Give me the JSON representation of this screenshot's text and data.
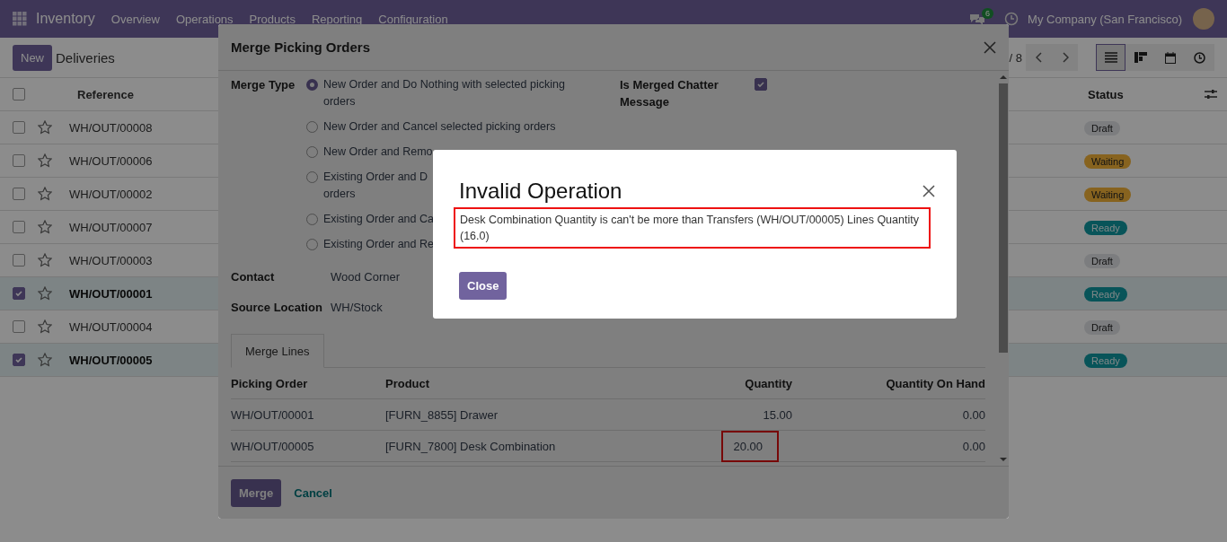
{
  "navbar": {
    "app": "Inventory",
    "menu": [
      "Overview",
      "Operations",
      "Products",
      "Reporting",
      "Configuration"
    ],
    "chat_badge": "6",
    "company": "My Company (San Francisco)"
  },
  "control_bar": {
    "new_button": "New",
    "breadcrumb": "Deliveries",
    "pager": "/ 8",
    "views": [
      {
        "kind": "list",
        "selected": true
      },
      {
        "kind": "kanban",
        "selected": false
      },
      {
        "kind": "calendar",
        "selected": false
      },
      {
        "kind": "activity",
        "selected": false
      }
    ]
  },
  "list": {
    "all_selected": false,
    "columns": [
      "Reference",
      "Status"
    ],
    "rows": [
      {
        "reference": "WH/OUT/00008",
        "status": "Draft",
        "kind": "draft",
        "selected": false
      },
      {
        "reference": "WH/OUT/00006",
        "status": "Waiting",
        "kind": "waiting",
        "selected": false
      },
      {
        "reference": "WH/OUT/00002",
        "status": "Waiting",
        "kind": "waiting",
        "selected": false
      },
      {
        "reference": "WH/OUT/00007",
        "status": "Ready",
        "kind": "ready",
        "selected": false
      },
      {
        "reference": "WH/OUT/00003",
        "status": "Draft",
        "kind": "draft",
        "selected": false
      },
      {
        "reference": "WH/OUT/00001",
        "status": "Ready",
        "kind": "ready",
        "selected": true
      },
      {
        "reference": "WH/OUT/00004",
        "status": "Draft",
        "kind": "draft",
        "selected": false
      },
      {
        "reference": "WH/OUT/00005",
        "status": "Ready",
        "kind": "ready",
        "selected": true
      }
    ]
  },
  "merge_dialog": {
    "title": "Merge Picking Orders",
    "merge_type_label": "Merge Type",
    "options": [
      {
        "lines": [
          "New Order and Do Nothing with selected picking",
          "orders"
        ],
        "selected": true
      },
      {
        "lines": [
          "New Order and Cancel selected picking orders"
        ],
        "selected": false
      },
      {
        "lines": [
          "New Order and Remo"
        ],
        "selected": false
      },
      {
        "lines": [
          "Existing Order and D",
          "orders"
        ],
        "selected": false
      },
      {
        "lines": [
          "Existing Order and Ca"
        ],
        "selected": false
      },
      {
        "lines": [
          "Existing Order and Re"
        ],
        "selected": false
      }
    ],
    "chatter_label": "Is Merged Chatter Message",
    "chatter_checked": true,
    "fields": [
      {
        "label": "Contact",
        "value": "Wood Corner"
      },
      {
        "label": "Source Location",
        "value": "WH/Stock"
      }
    ],
    "tab": "Merge Lines",
    "columns": [
      "Picking Order",
      "Product",
      "Quantity",
      "Quantity On Hand"
    ],
    "rows": [
      {
        "picking_order": "WH/OUT/00001",
        "product": "[FURN_8855] Drawer",
        "quantity": "15.00",
        "on_hand": "0.00",
        "highlighted": false
      },
      {
        "picking_order": "WH/OUT/00005",
        "product": "[FURN_7800] Desk Combination",
        "quantity": "20.00",
        "on_hand": "0.00",
        "highlighted": true
      }
    ],
    "buttons": [
      "Merge",
      "Cancel"
    ]
  },
  "error_dialog": {
    "title": "Invalid Operation",
    "message": "Desk Combination Quantity is can't be more than Transfers (WH/OUT/00005) Lines Quantity (16.0)",
    "highlighted": true,
    "button": "Close"
  }
}
